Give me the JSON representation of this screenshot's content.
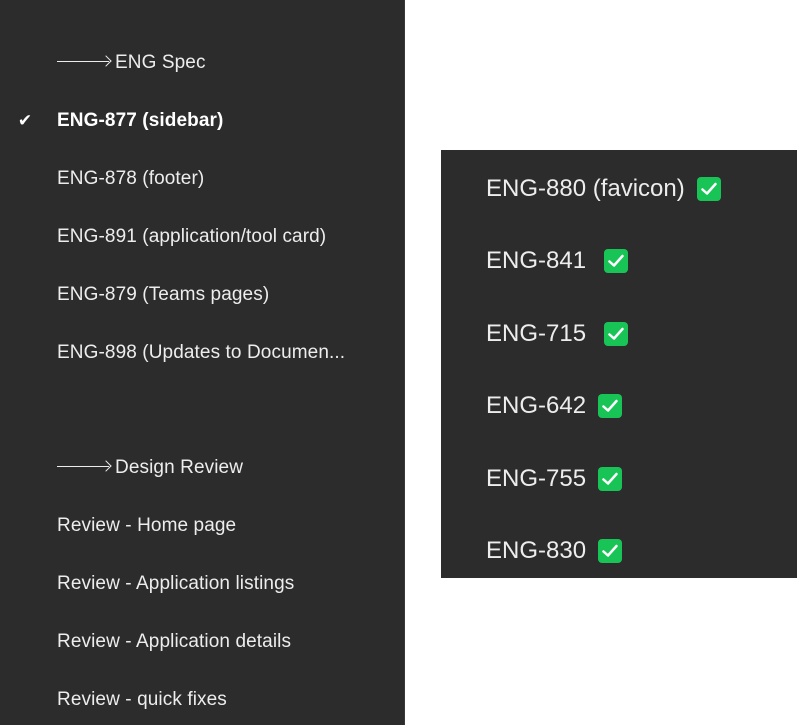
{
  "left_menu": {
    "items": [
      {
        "label": "ENG Spec",
        "type": "heading"
      },
      {
        "label": "ENG-877 (sidebar)",
        "type": "item",
        "selected": true
      },
      {
        "label": "ENG-878 (footer)",
        "type": "item"
      },
      {
        "label": "ENG-891 (application/tool card)",
        "type": "item"
      },
      {
        "label": "ENG-879 (Teams pages)",
        "type": "item"
      },
      {
        "label": "ENG-898 (Updates to Documen...",
        "type": "item"
      },
      {
        "label": "Design Review",
        "type": "heading"
      },
      {
        "label": "Review - Home page",
        "type": "item"
      },
      {
        "label": "Review - Application listings",
        "type": "item"
      },
      {
        "label": "Review - Application details",
        "type": "item"
      },
      {
        "label": "Review - quick fixes",
        "type": "item"
      }
    ]
  },
  "right_list": {
    "items": [
      {
        "label": "ENG-880 (favicon)",
        "checked": true
      },
      {
        "label": "ENG-841",
        "checked": true
      },
      {
        "label": "ENG-715",
        "checked": true
      },
      {
        "label": "ENG-642",
        "checked": true
      },
      {
        "label": "ENG-755",
        "checked": true
      },
      {
        "label": "ENG-830",
        "checked": true
      }
    ]
  },
  "colors": {
    "panel_bg": "#2c2c2c",
    "text": "#ededed",
    "check_green": "#19c456"
  }
}
